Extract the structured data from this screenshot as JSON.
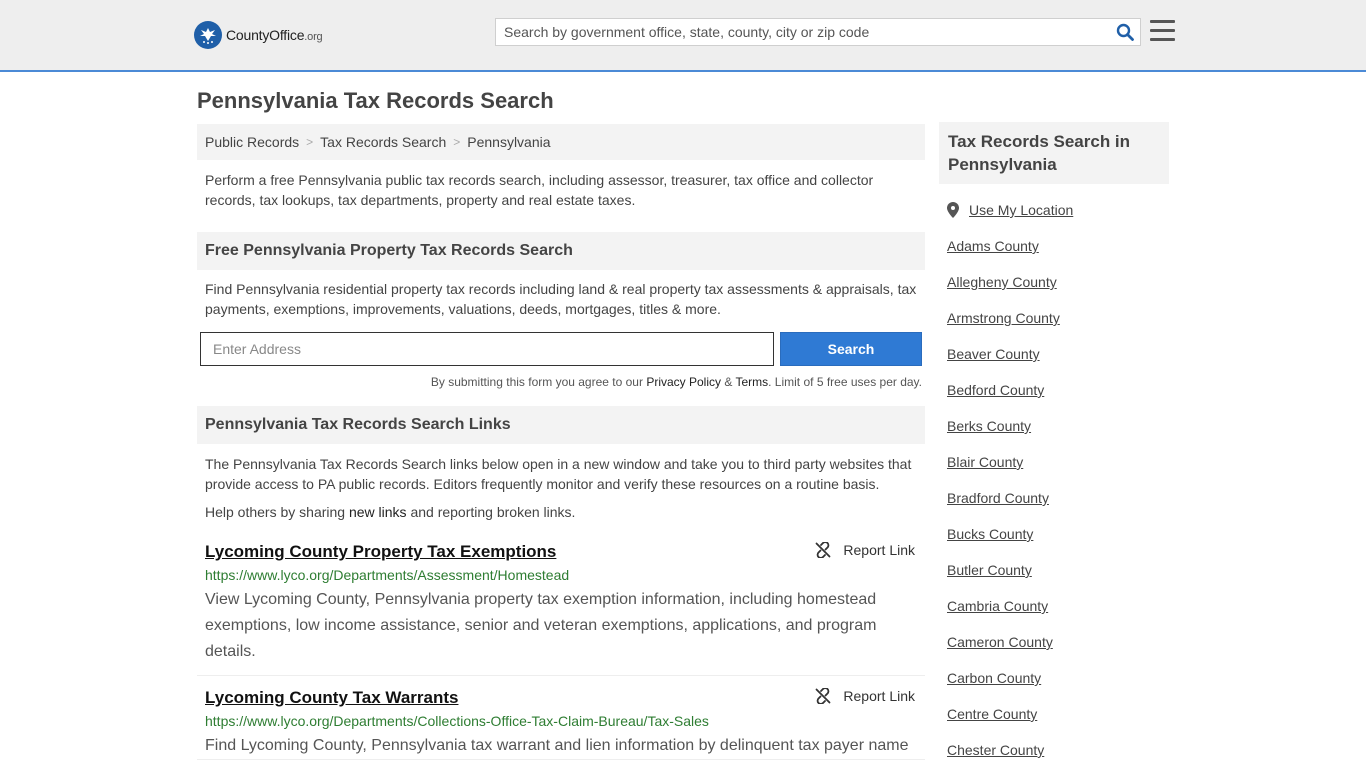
{
  "header": {
    "logo_text_a": "County",
    "logo_text_b": "Office",
    "logo_text_c": ".org",
    "search_placeholder": "Search by government office, state, county, city or zip code"
  },
  "page": {
    "title": "Pennsylvania Tax Records Search"
  },
  "breadcrumb": [
    "Public Records",
    "Tax Records Search",
    "Pennsylvania"
  ],
  "intro": "Perform a free Pennsylvania public tax records search, including assessor, treasurer, tax office and collector records, tax lookups, tax departments, property and real estate taxes.",
  "property_search": {
    "heading": "Free Pennsylvania Property Tax Records Search",
    "text": "Find Pennsylvania residential property tax records including land & real property tax assessments & appraisals, tax payments, exemptions, improvements, valuations, deeds, mortgages, titles & more.",
    "input_placeholder": "Enter Address",
    "button_label": "Search",
    "disclaimer_a": "By submitting this form you agree to our ",
    "privacy_link": "Privacy Policy",
    "disclaimer_b": " & ",
    "terms_link": "Terms",
    "disclaimer_c": ". Limit of 5 free uses per day."
  },
  "links_section": {
    "heading": "Pennsylvania Tax Records Search Links",
    "text": "The Pennsylvania Tax Records Search links below open in a new window and take you to third party websites that provide access to PA public records. Editors frequently monitor and verify these resources on a routine basis.",
    "share_a": "Help others by sharing ",
    "share_link": "new links",
    "share_b": " and reporting broken links.",
    "report_label": "Report Link",
    "results": [
      {
        "title": "Lycoming County Property Tax Exemptions",
        "url": "https://www.lyco.org/Departments/Assessment/Homestead",
        "desc": "View Lycoming County, Pennsylvania property tax exemption information, including homestead exemptions, low income assistance, senior and veteran exemptions, applications, and program details."
      },
      {
        "title": "Lycoming County Tax Warrants",
        "url": "https://www.lyco.org/Departments/Collections-Office-Tax-Claim-Bureau/Tax-Sales",
        "desc": "Find Lycoming County, Pennsylvania tax warrant and lien information by delinquent tax payer name"
      }
    ]
  },
  "sidebar": {
    "heading": "Tax Records Search in Pennsylvania",
    "use_location": "Use My Location",
    "counties": [
      "Adams County",
      "Allegheny County",
      "Armstrong County",
      "Beaver County",
      "Bedford County",
      "Berks County",
      "Blair County",
      "Bradford County",
      "Bucks County",
      "Butler County",
      "Cambria County",
      "Cameron County",
      "Carbon County",
      "Centre County",
      "Chester County"
    ]
  },
  "colors": {
    "accent": "#2f7ad4",
    "url_green": "#2e7d32",
    "logo_blue": "#1f5fa8"
  }
}
